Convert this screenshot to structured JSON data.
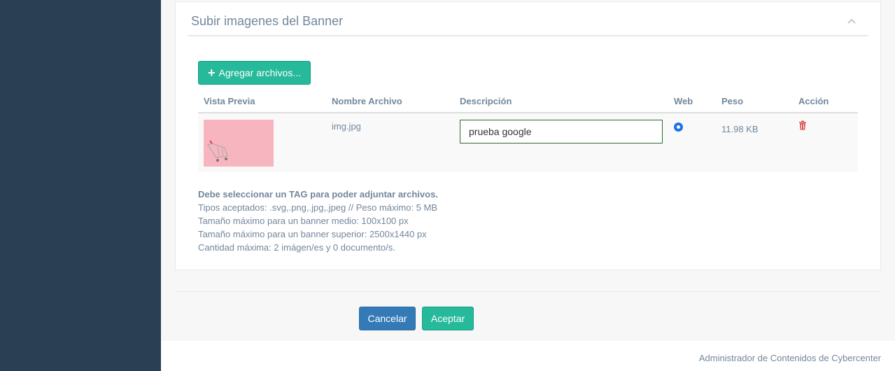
{
  "panel": {
    "title": "Subir imagenes del Banner",
    "add_button_label": "Agregar archivos...",
    "add_icon": "plus-icon",
    "collapse_icon": "chevron-up-icon"
  },
  "table": {
    "headers": [
      "Vista Previa",
      "Nombre Archivo",
      "Descripción",
      "Web",
      "Peso",
      "Acción"
    ],
    "rows": [
      {
        "preview": "shopping-cart-image",
        "filename": "img.jpg",
        "description": "prueba google",
        "web_selected": true,
        "size": "11.98 KB",
        "action_icon": "trash-icon"
      }
    ]
  },
  "notes": {
    "warning": "Debe seleccionar un TAG para poder adjuntar archivos.",
    "lines": [
      "Tipos aceptados: .svg,.png,.jpg,.jpeg // Peso máximo: 5 MB",
      "Tamaño máximo para un banner medio: 100x100 px",
      "Tamaño máximo para un banner superior: 2500x1440 px",
      "Cantidad máxima: 2 imágen/es y 0 documento/s."
    ]
  },
  "actions": {
    "cancel_label": "Cancelar",
    "accept_label": "Aceptar"
  },
  "footer": {
    "text": "Administrador de Contenidos de Cybercenter"
  },
  "colors": {
    "sidebar": "#2A3F54",
    "primary_green": "#26B99A",
    "primary_blue": "#337AB7",
    "danger": "#D9534F"
  }
}
